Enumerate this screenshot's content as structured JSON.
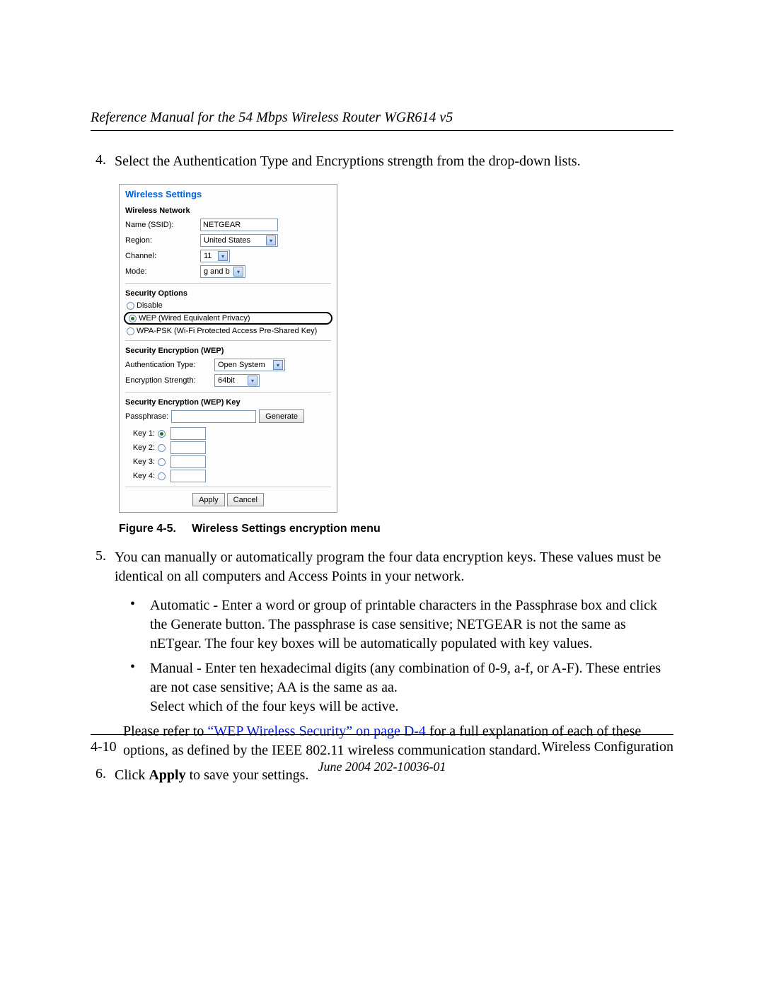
{
  "header": {
    "title": "Reference Manual for the 54 Mbps Wireless Router WGR614 v5"
  },
  "steps": {
    "s4": {
      "num": "4.",
      "text": "Select the Authentication Type and Encryptions strength from the drop-down lists."
    },
    "s5": {
      "num": "5.",
      "text": "You can manually or automatically program the four data encryption keys. These values must be identical on all computers and Access Points in your network.",
      "bullets": [
        "Automatic - Enter a word or group of printable characters in the Passphrase box and click the Generate button. The passphrase is case sensitive; NETGEAR is not the same as nETgear. The four key boxes will be automatically populated with key values.",
        "Manual - Enter ten hexadecimal digits (any combination of 0-9, a-f, or A-F). These entries are not case sensitive; AA is the same as aa.\nSelect which of the four keys will be active."
      ],
      "ref_pre": "Please refer to ",
      "ref_link": "“WEP Wireless Security” on page D-4",
      "ref_post": " for a full explanation of each of these options, as defined by the IEEE 802.11 wireless communication standard."
    },
    "s6": {
      "num": "6.",
      "pre": "Click ",
      "bold": "Apply",
      "post": " to save your settings."
    }
  },
  "figure": {
    "caption_label": "Figure 4-5.",
    "caption_text": "Wireless Settings encryption menu",
    "ui": {
      "title": "Wireless Settings",
      "wireless_network": {
        "heading": "Wireless Network",
        "ssid_label": "Name (SSID):",
        "ssid_value": "NETGEAR",
        "region_label": "Region:",
        "region_value": "United States",
        "channel_label": "Channel:",
        "channel_value": "11",
        "mode_label": "Mode:",
        "mode_value": "g and b"
      },
      "security_options": {
        "heading": "Security Options",
        "disable": "Disable",
        "wep": "WEP (Wired Equivalent Privacy)",
        "wpa": "WPA-PSK (Wi-Fi Protected Access Pre-Shared Key)"
      },
      "enc_wep": {
        "heading": "Security Encryption (WEP)",
        "auth_label": "Authentication Type:",
        "auth_value": "Open System",
        "str_label": "Encryption Strength:",
        "str_value": "64bit"
      },
      "enc_key": {
        "heading": "Security Encryption (WEP) Key",
        "pass_label": "Passphrase:",
        "generate": "Generate",
        "k1": "Key 1:",
        "k2": "Key 2:",
        "k3": "Key 3:",
        "k4": "Key 4:"
      },
      "buttons": {
        "apply": "Apply",
        "cancel": "Cancel"
      }
    }
  },
  "footer": {
    "page": "4-10",
    "section": "Wireless Configuration",
    "date": "June 2004 202-10036-01"
  }
}
